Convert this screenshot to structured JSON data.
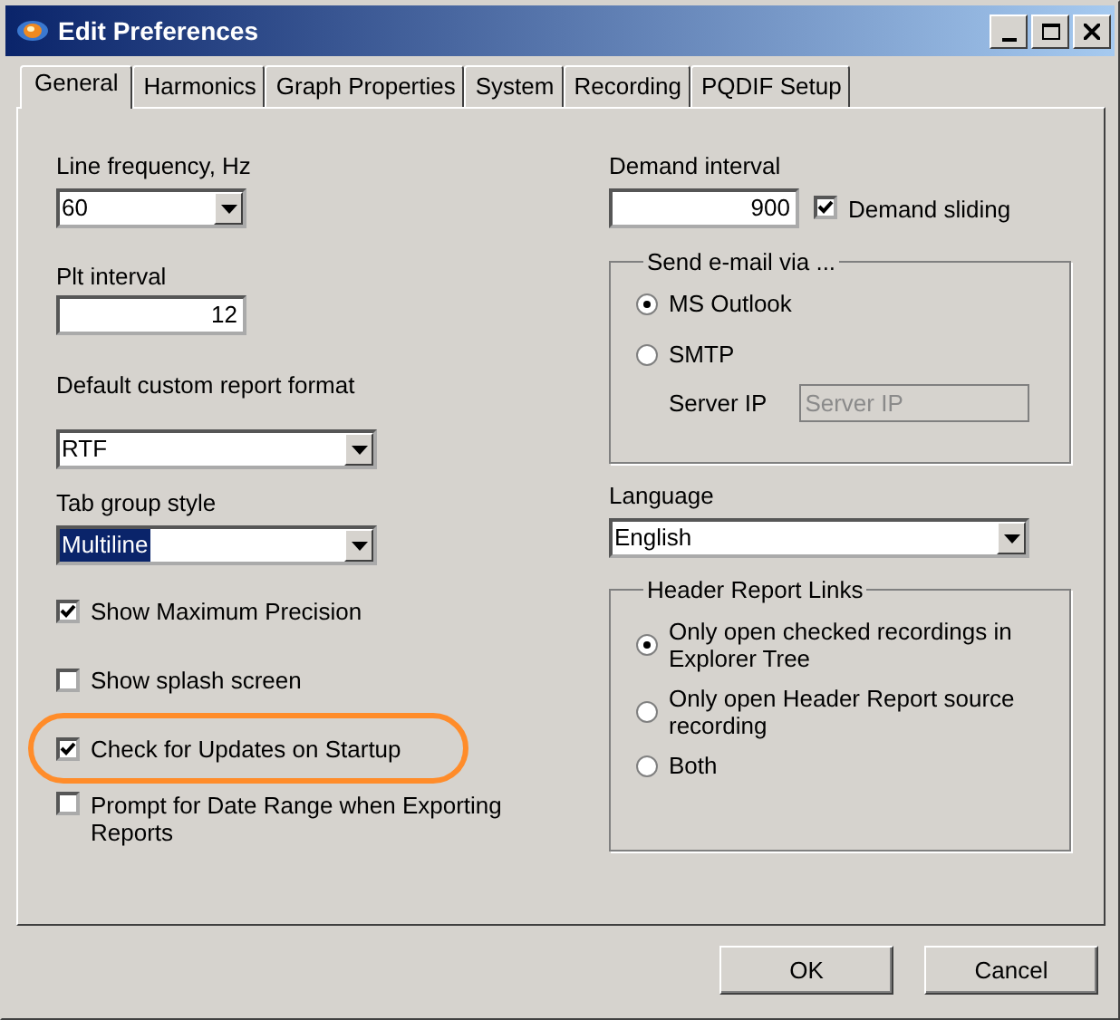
{
  "window": {
    "title": "Edit Preferences"
  },
  "tabs": [
    {
      "label": "General",
      "selected": true
    },
    {
      "label": "Harmonics",
      "selected": false
    },
    {
      "label": "Graph Properties",
      "selected": false
    },
    {
      "label": "System",
      "selected": false
    },
    {
      "label": "Recording",
      "selected": false
    },
    {
      "label": "PQDIF Setup",
      "selected": false
    }
  ],
  "left_column": [
    {
      "kind": "dropdown",
      "label": "Line frequency, Hz",
      "value": "60",
      "value_selected": false
    },
    {
      "kind": "number",
      "label": "Plt interval",
      "value": "12"
    },
    {
      "kind": "dropdown",
      "label": "Default custom report format",
      "value": "RTF",
      "value_selected": false
    },
    {
      "kind": "dropdown",
      "label": "Tab group style",
      "value": "Multiline",
      "value_selected": true
    },
    {
      "kind": "checkbox",
      "label": "Show Maximum Precision",
      "checked": true,
      "highlighted": false
    },
    {
      "kind": "checkbox",
      "label": "Show splash screen",
      "checked": false,
      "highlighted": false
    },
    {
      "kind": "checkbox",
      "label": "Check for Updates on Startup",
      "checked": true,
      "highlighted": true
    },
    {
      "kind": "checkbox",
      "label": "Prompt for Date Range when Exporting Reports",
      "checked": false,
      "highlighted": false
    }
  ],
  "demand": {
    "label": "Demand interval",
    "value": "900",
    "sliding_label": "Demand sliding",
    "sliding_checked": true
  },
  "email_group": {
    "title": "Send e-mail via ...",
    "options": [
      {
        "label": "MS Outlook",
        "selected": true
      },
      {
        "label": "SMTP",
        "selected": false
      }
    ],
    "server_ip": {
      "label": "Server IP",
      "placeholder": "Server IP",
      "disabled": true
    }
  },
  "language": {
    "label": "Language",
    "value": "English"
  },
  "header_links_group": {
    "title": "Header Report Links",
    "options": [
      {
        "label": "Only open checked recordings in Explorer Tree",
        "selected": true
      },
      {
        "label": "Only open Header Report source recording",
        "selected": false
      },
      {
        "label": "Both",
        "selected": false
      }
    ]
  },
  "buttons": [
    "OK",
    "Cancel"
  ]
}
